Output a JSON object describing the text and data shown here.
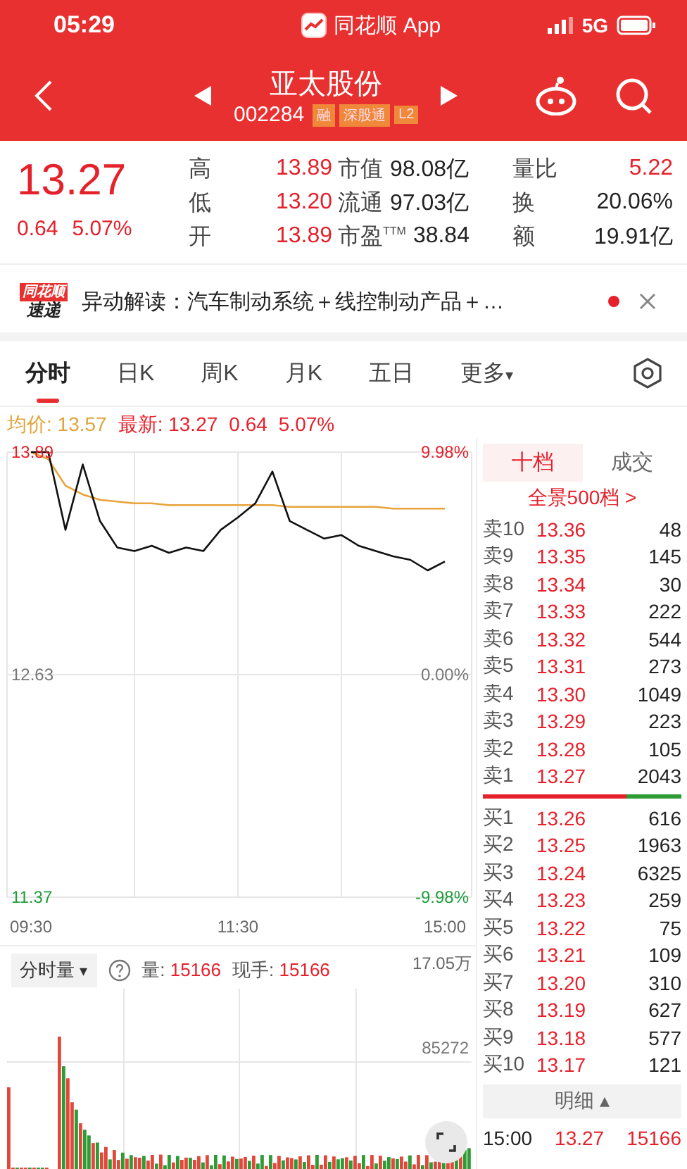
{
  "status_bar": {
    "time": "05:29",
    "app": "同花顺 App",
    "network": "5G"
  },
  "nav": {
    "title": "亚太股份",
    "code": "002284",
    "badges": [
      "融",
      "深股通",
      "L2"
    ]
  },
  "quote": {
    "price": "13.27",
    "change": "0.64",
    "percent": "5.07%",
    "stats": [
      {
        "label": "高",
        "value": "13.89",
        "kind": "up"
      },
      {
        "label": "市值",
        "value": "98.08亿",
        "kind": "plain"
      },
      {
        "label": "量比",
        "value": "5.22",
        "kind": "up"
      },
      {
        "label": "低",
        "value": "13.20",
        "kind": "up"
      },
      {
        "label": "流通",
        "value": "97.03亿",
        "kind": "plain"
      },
      {
        "label": "换",
        "value": "20.06%",
        "kind": "plain"
      },
      {
        "label": "开",
        "value": "13.89",
        "kind": "up"
      },
      {
        "label": "市盈$^{TTM}$",
        "value": "38.84",
        "kind": "plain"
      },
      {
        "label": "额",
        "value": "19.91亿",
        "kind": "plain"
      }
    ]
  },
  "news": {
    "logo_top": "同花顺",
    "logo_bottom": "速递",
    "text": "异动解读：汽车制动系统＋线控制动产品＋…",
    "unread": true
  },
  "chart_tabs": [
    {
      "label": "分时",
      "selected": true
    },
    {
      "label": "日K",
      "selected": false
    },
    {
      "label": "周K",
      "selected": false
    },
    {
      "label": "月K",
      "selected": false
    },
    {
      "label": "五日",
      "selected": false
    },
    {
      "label": "更多",
      "selected": false,
      "caret": "▾"
    }
  ],
  "info": {
    "separator": ": ",
    "avg_value": "13.57",
    "latest_value": "13.27",
    "change": "0.64",
    "percent": "5.07%"
  },
  "price_chart": {
    "high_pct": "9.98%",
    "mid_pct": "0.00%",
    "low_pct": "-9.98%",
    "chart_data": {
      "type": "line",
      "grid": true,
      "categories": [
        "09:30",
        null,
        null,
        null,
        null,
        null,
        null,
        null,
        null,
        null,
        null,
        null,
        "11:30",
        null,
        null,
        null,
        null,
        null,
        null,
        null,
        null,
        null,
        null,
        null,
        "15:00"
      ],
      "ylim": [
        11.37,
        13.89
      ],
      "yticks": [
        13.89,
        12.63,
        11.37
      ],
      "series": [
        {
          "name": "最新",
          "color": "#111111",
          "values": [
            13.89,
            13.89,
            13.45,
            13.82,
            13.5,
            13.35,
            13.33,
            13.36,
            13.32,
            13.35,
            13.33,
            13.45,
            13.52,
            13.6,
            13.78,
            13.5,
            13.45,
            13.4,
            13.42,
            13.36,
            13.33,
            13.3,
            13.28,
            13.22,
            13.27
          ]
        },
        {
          "name": "均价",
          "color": "#e8a33a",
          "values": [
            13.89,
            13.85,
            13.7,
            13.65,
            13.62,
            13.61,
            13.6,
            13.6,
            13.59,
            13.59,
            13.59,
            13.59,
            13.59,
            13.59,
            13.59,
            13.58,
            13.58,
            13.58,
            13.58,
            13.58,
            13.58,
            13.57,
            13.57,
            13.57,
            13.57
          ]
        }
      ]
    }
  },
  "volume_chart": {
    "selector": "分时量",
    "selector_caret": "▾",
    "volume": "量: ",
    "volume_value": "15166",
    "hand": "现手: ",
    "hand_value": "15166",
    "max": "17.05万",
    "mid": "85272"
  },
  "order_book": {
    "tabs": [
      {
        "label": "十档",
        "selected": true
      },
      {
        "label": "成交",
        "selected": false
      }
    ],
    "link": "全景500档 >",
    "asks": [
      {
        "label": "卖10",
        "price": "13.36",
        "qty": "48"
      },
      {
        "label": "卖9",
        "price": "13.35",
        "qty": "145"
      },
      {
        "label": "卖8",
        "price": "13.34",
        "qty": "30"
      },
      {
        "label": "卖7",
        "price": "13.33",
        "qty": "222"
      },
      {
        "label": "卖6",
        "price": "13.32",
        "qty": "544"
      },
      {
        "label": "卖5",
        "price": "13.31",
        "qty": "273"
      },
      {
        "label": "卖4",
        "price": "13.30",
        "qty": "1049"
      },
      {
        "label": "卖3",
        "price": "13.29",
        "qty": "223"
      },
      {
        "label": "卖2",
        "price": "13.28",
        "qty": "105"
      },
      {
        "label": "卖1",
        "price": "13.27",
        "qty": "2043"
      }
    ],
    "ratio": {
      "level": 0.72
    },
    "bids": [
      {
        "label": "买1",
        "price": "13.26",
        "qty": "616"
      },
      {
        "label": "买2",
        "price": "13.25",
        "qty": "1963"
      },
      {
        "label": "买3",
        "price": "13.24",
        "qty": "6325"
      },
      {
        "label": "买4",
        "price": "13.23",
        "qty": "259"
      },
      {
        "label": "买5",
        "price": "13.22",
        "qty": "75"
      },
      {
        "label": "买6",
        "price": "13.21",
        "qty": "109"
      },
      {
        "label": "买7",
        "price": "13.20",
        "qty": "310"
      },
      {
        "label": "买8",
        "price": "13.19",
        "qty": "627"
      },
      {
        "label": "买9",
        "price": "13.18",
        "qty": "577"
      },
      {
        "label": "买10",
        "price": "13.17",
        "qty": "121"
      }
    ],
    "detail_button": "明细 ▴",
    "last_trade": {
      "time": "15:00",
      "price": "13.27",
      "qty": "15166"
    }
  }
}
